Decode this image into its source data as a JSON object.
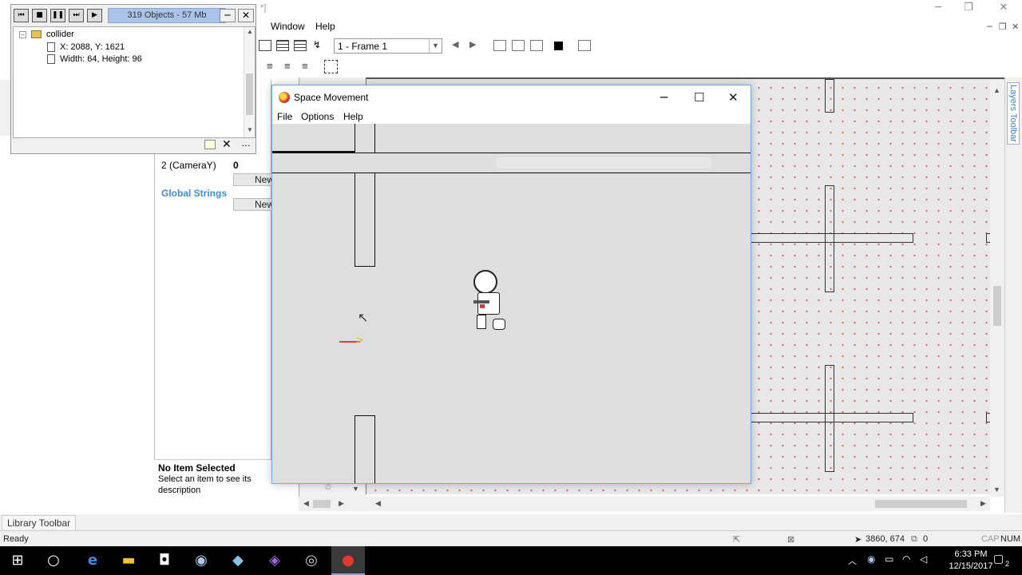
{
  "main_window": {
    "title_fragment": "*]",
    "menu": [
      "Window",
      "Help"
    ],
    "frame_select": "1 - Frame 1"
  },
  "debugger": {
    "status": "319 Objects - 57 Mb",
    "tree": {
      "root": "collider",
      "children": [
        "X: 2088, Y: 1621",
        "Width: 64, Height: 96"
      ]
    }
  },
  "properties": {
    "rows": [
      {
        "name": "2 (CameraY)",
        "value": "0"
      }
    ],
    "new_label": "New",
    "global_strings": "Global Strings",
    "description": {
      "title": "No Item Selected",
      "text": "Select an item to see its description"
    }
  },
  "game_window": {
    "title": "Space Movement",
    "menu": [
      "File",
      "Options",
      "Help"
    ]
  },
  "layers_toolbar": "Layers Toolbar",
  "library_toolbar": "Library Toolbar",
  "statusbar": {
    "ready": "Ready",
    "coords": "3860, 674",
    "count": "0",
    "caps": "CAP",
    "num": "NUM"
  },
  "taskbar": {
    "time": "6:33 PM",
    "date": "12/15/2017",
    "notifications": "2"
  },
  "colors": {
    "frame_dots": "#d07070",
    "debugger_status": "#a9c4e8",
    "global_strings": "#3c8fd0"
  }
}
